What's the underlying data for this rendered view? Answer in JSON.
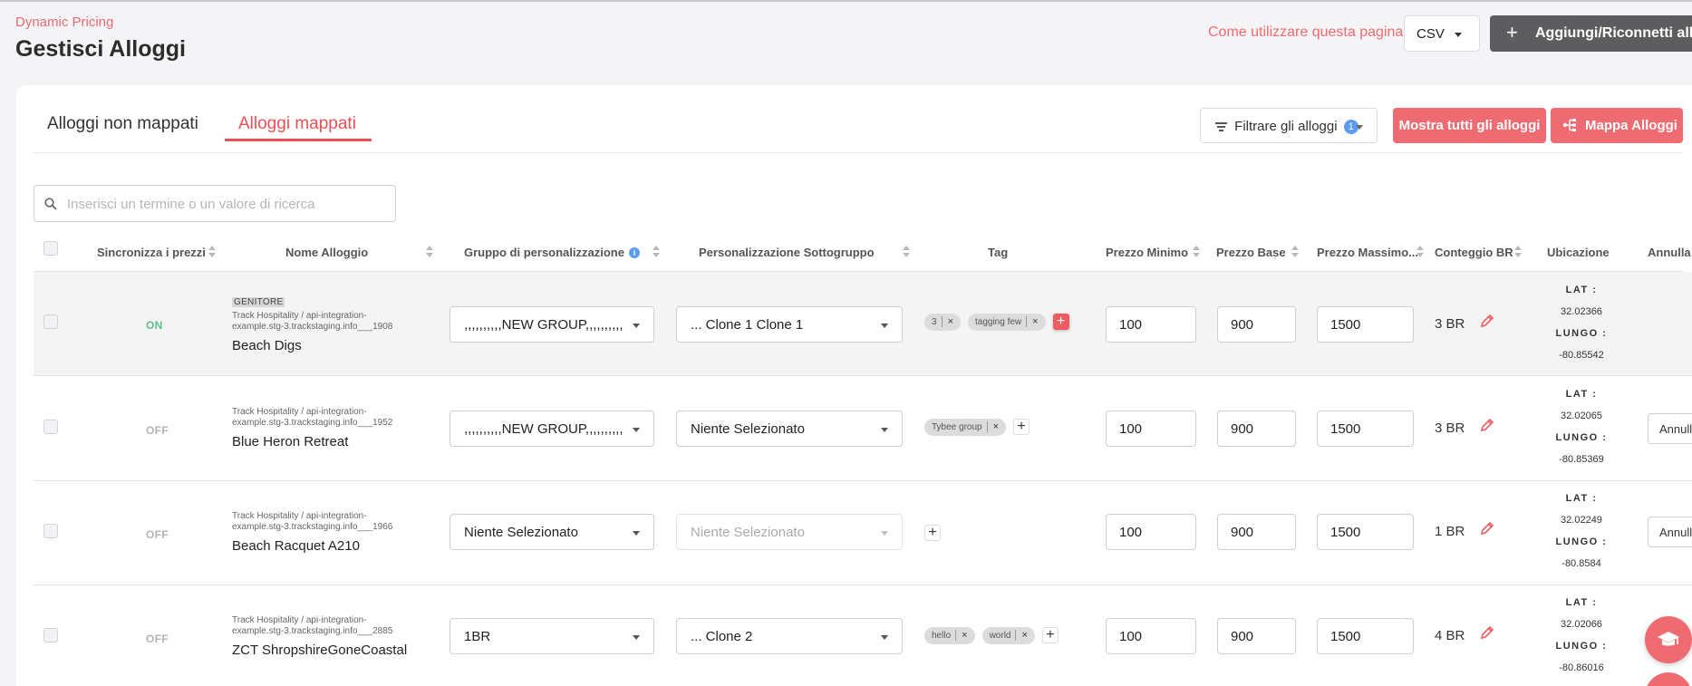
{
  "header": {
    "brand": "Dynamic Pricing",
    "title": "Gestisci Alloggi",
    "help_link": "Come utilizzare questa pagina?",
    "export_format": "CSV",
    "add_button": "Aggiungi/Riconnetti alloggi"
  },
  "tabs": [
    {
      "label": "Alloggi non mappati",
      "active": false
    },
    {
      "label": "Alloggi mappati",
      "active": true
    }
  ],
  "toolbar": {
    "filter_label": "Filtrare gli alloggi",
    "filter_count": "1",
    "show_all_label": "Mostra tutti gli alloggi",
    "map_label": "Mappa Alloggi"
  },
  "search": {
    "placeholder": "Inserisci un termine o un valore di ricerca"
  },
  "table": {
    "columns": {
      "sync": "Sincronizza i prezzi",
      "name": "Nome Alloggio",
      "group": "Gruppo di personalizzazione",
      "subgroup": "Personalizzazione Sottogruppo",
      "tag": "Tag",
      "min": "Prezzo Minimo",
      "base": "Prezzo Base",
      "max": "Prezzo Massimo...",
      "br": "Conteggio BR",
      "location": "Ubicazione",
      "cancel": "Annulla"
    },
    "lat_label": "LAT :",
    "lng_label": "LUNGO :",
    "rows": [
      {
        "sync": "ON",
        "parent_tag": "GENITORE",
        "path": "Track Hospitality / api-integration-example.stg-3.trackstaging.info___1908",
        "name": "Beach Digs",
        "group": ",,,,,,,,,,NEW GROUP,,,,,,,,,,",
        "subgroup": "... Clone 1 Clone 1",
        "subgroup_disabled": false,
        "tags": [
          "3",
          "tagging few"
        ],
        "min": "100",
        "base": "900",
        "max": "1500",
        "br": "3 BR",
        "lat": "32.02366",
        "lng": "-80.85542",
        "cancel": ""
      },
      {
        "sync": "OFF",
        "parent_tag": "",
        "path": "Track Hospitality / api-integration-example.stg-3.trackstaging.info___1952",
        "name": "Blue Heron Retreat",
        "group": ",,,,,,,,,,NEW GROUP,,,,,,,,,,",
        "subgroup": "Niente Selezionato",
        "subgroup_disabled": false,
        "tags": [
          "Tybee group"
        ],
        "min": "100",
        "base": "900",
        "max": "1500",
        "br": "3 BR",
        "lat": "32.02065",
        "lng": "-80.85369",
        "cancel": "Annulla"
      },
      {
        "sync": "OFF",
        "parent_tag": "",
        "path": "Track Hospitality / api-integration-example.stg-3.trackstaging.info___1966",
        "name": "Beach Racquet A210",
        "group": "Niente Selezionato",
        "subgroup": "Niente Selezionato",
        "subgroup_disabled": true,
        "tags": [],
        "min": "100",
        "base": "900",
        "max": "1500",
        "br": "1 BR",
        "lat": "32.02249",
        "lng": "-80.8584",
        "cancel": "Annulla"
      },
      {
        "sync": "OFF",
        "parent_tag": "",
        "path": "Track Hospitality / api-integration-example.stg-3.trackstaging.info___2885",
        "name": "ZCT ShropshireGoneCoastal",
        "group": "1BR",
        "subgroup": "... Clone 2",
        "subgroup_disabled": false,
        "tags": [
          "hello",
          "world"
        ],
        "min": "100",
        "base": "900",
        "max": "1500",
        "br": "4 BR",
        "lat": "32.02066",
        "lng": "-80.86016",
        "cancel": ""
      }
    ]
  },
  "colors": {
    "accent": "#ee6b71",
    "tab_active": "#ee4f55",
    "sync_on": "#5cc08a",
    "badge": "#5b9bf0"
  },
  "icons": [
    "plus-icon",
    "filter-icon",
    "map-icon",
    "search-icon",
    "info-icon",
    "pencil-icon",
    "graduation-cap-icon"
  ]
}
